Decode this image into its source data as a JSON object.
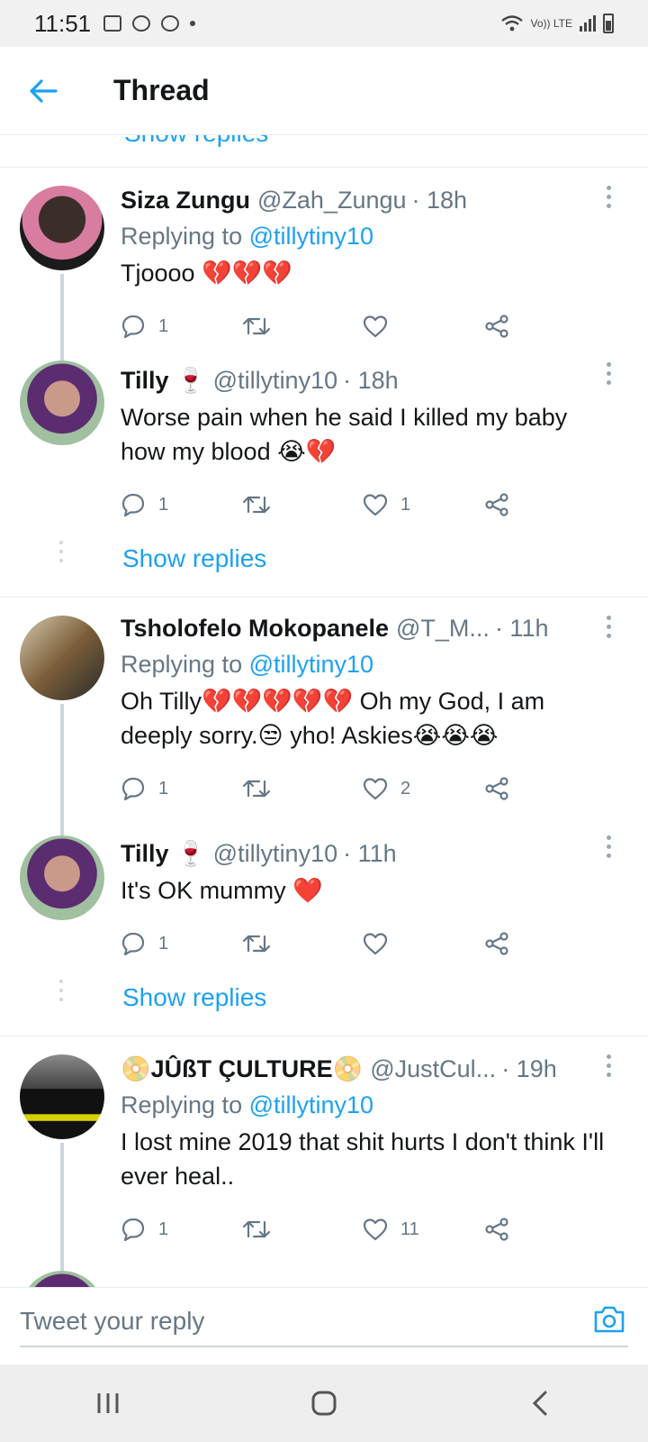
{
  "status_bar": {
    "time": "11:51",
    "network_label": "Vo)) LTE"
  },
  "header": {
    "title": "Thread"
  },
  "top_cutoff": {
    "show_replies_label": "Show replies"
  },
  "tweets": [
    {
      "name": "Siza Zungu",
      "handle": "@Zah_Zungu",
      "time": "· 18h",
      "replying_prefix": "Replying to ",
      "replying_to": "@tillytiny10",
      "text": "Tjoooo 💔💔💔",
      "replies": "1",
      "retweets": "",
      "likes": ""
    },
    {
      "name": "Tilly 🍷",
      "handle": "@tillytiny10",
      "time": "· 18h",
      "text": "Worse pain when he said I killed my baby how my blood 😭💔",
      "replies": "1",
      "retweets": "",
      "likes": "1",
      "show_replies": "Show replies"
    },
    {
      "name": "Tsholofelo Mokopanele",
      "handle": "@T_M...",
      "time": "· 11h",
      "replying_prefix": "Replying to ",
      "replying_to": "@tillytiny10",
      "text": "Oh Tilly💔💔💔💔💔 Oh my God, I am deeply sorry.😒 yho! Askies😭😭😭",
      "replies": "1",
      "retweets": "",
      "likes": "2"
    },
    {
      "name": "Tilly 🍷",
      "handle": "@tillytiny10",
      "time": "· 11h",
      "text": "It's OK mummy ❤️",
      "replies": "1",
      "retweets": "",
      "likes": "",
      "show_replies": "Show replies"
    },
    {
      "name": "📀JÛßT ÇULTURE📀",
      "handle": "@JustCul...",
      "time": "· 19h",
      "replying_prefix": "Replying to ",
      "replying_to": "@tillytiny10",
      "text": "I lost mine 2019 that shit hurts I don't think I'll ever heal..",
      "replies": "1",
      "retweets": "",
      "likes": "11"
    }
  ],
  "reply_bar": {
    "placeholder": "Tweet your reply"
  },
  "colors": {
    "accent": "#1da1f2",
    "muted": "#657786",
    "divider": "#e6ecf0"
  }
}
